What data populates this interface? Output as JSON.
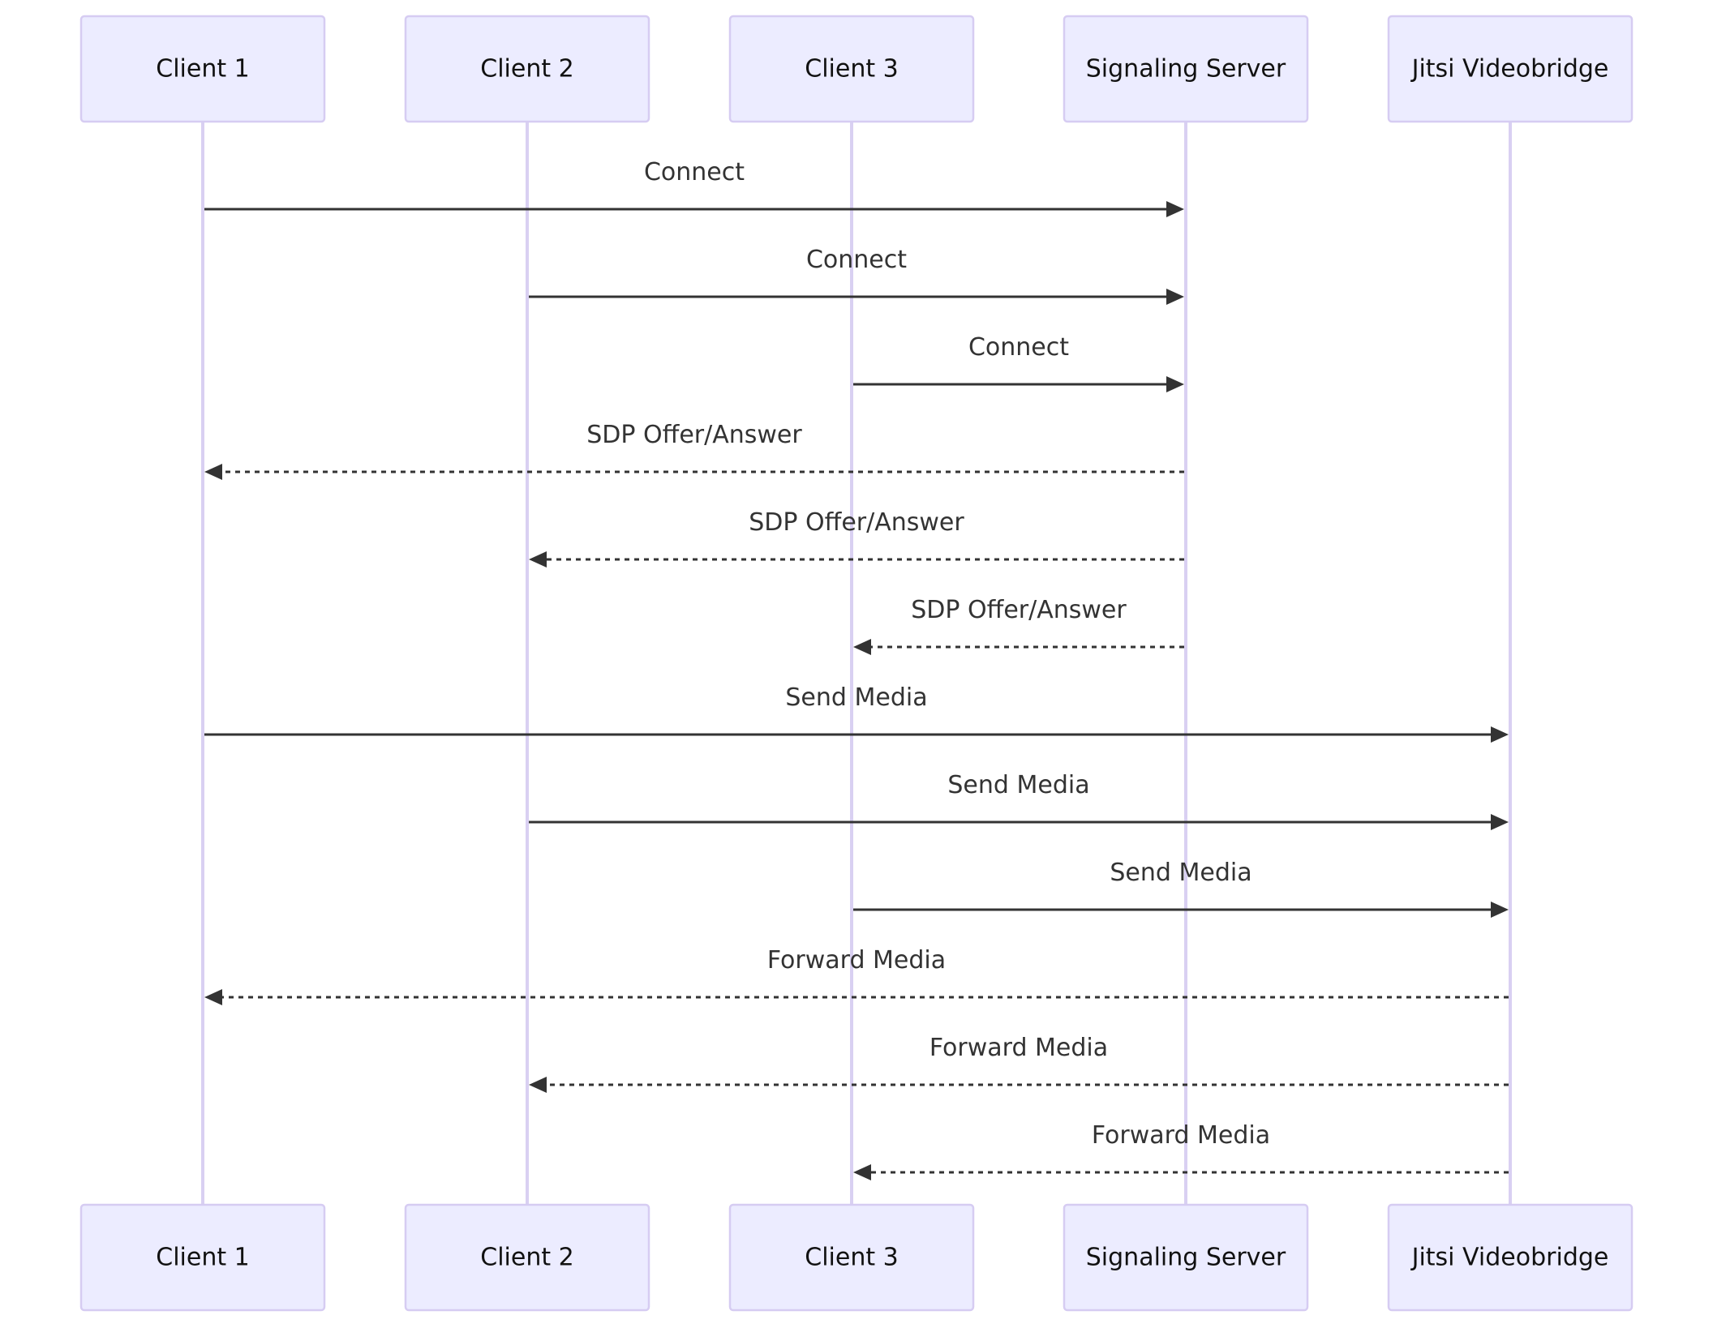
{
  "diagram": {
    "type": "sequence",
    "participants": [
      {
        "id": "client1",
        "label": "Client 1"
      },
      {
        "id": "client2",
        "label": "Client 2"
      },
      {
        "id": "client3",
        "label": "Client 3"
      },
      {
        "id": "signaling",
        "label": "Signaling Server"
      },
      {
        "id": "jvb",
        "label": "Jitsi Videobridge"
      }
    ],
    "messages": [
      {
        "from": "client1",
        "to": "signaling",
        "label": "Connect",
        "style": "solid"
      },
      {
        "from": "client2",
        "to": "signaling",
        "label": "Connect",
        "style": "solid"
      },
      {
        "from": "client3",
        "to": "signaling",
        "label": "Connect",
        "style": "solid"
      },
      {
        "from": "signaling",
        "to": "client1",
        "label": "SDP Offer/Answer",
        "style": "dashed"
      },
      {
        "from": "signaling",
        "to": "client2",
        "label": "SDP Offer/Answer",
        "style": "dashed"
      },
      {
        "from": "signaling",
        "to": "client3",
        "label": "SDP Offer/Answer",
        "style": "dashed"
      },
      {
        "from": "client1",
        "to": "jvb",
        "label": "Send Media",
        "style": "solid"
      },
      {
        "from": "client2",
        "to": "jvb",
        "label": "Send Media",
        "style": "solid"
      },
      {
        "from": "client3",
        "to": "jvb",
        "label": "Send Media",
        "style": "solid"
      },
      {
        "from": "jvb",
        "to": "client1",
        "label": "Forward Media",
        "style": "dashed"
      },
      {
        "from": "jvb",
        "to": "client2",
        "label": "Forward Media",
        "style": "dashed"
      },
      {
        "from": "jvb",
        "to": "client3",
        "label": "Forward Media",
        "style": "dashed"
      }
    ],
    "colors": {
      "actor_fill": "#ECECFF",
      "actor_border": "#D6CCF2",
      "lifeline": "#D9D0F2",
      "message": "#333333"
    }
  }
}
